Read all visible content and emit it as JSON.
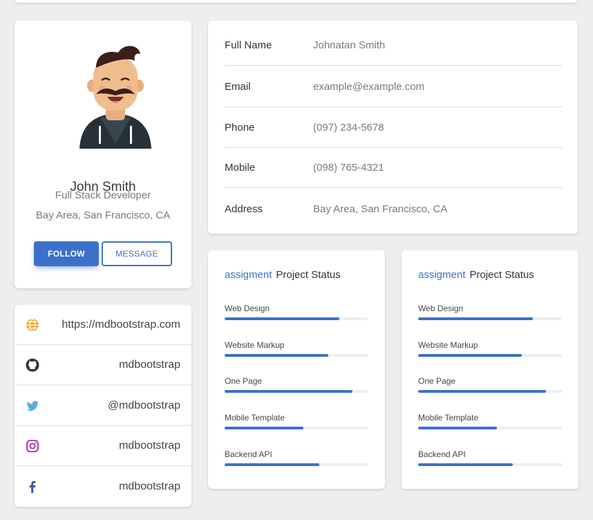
{
  "profile": {
    "name": "John Smith",
    "role": "Full Stack Developer",
    "location": "Bay Area, San Francisco, CA",
    "follow_label": "FOLLOW",
    "message_label": "MESSAGE"
  },
  "social": [
    {
      "icon": "globe-icon",
      "text": "https://mdbootstrap.com",
      "color": "#f5a623"
    },
    {
      "icon": "github-icon",
      "text": "mdbootstrap",
      "color": "#333333"
    },
    {
      "icon": "twitter-icon",
      "text": "@mdbootstrap",
      "color": "#55acee"
    },
    {
      "icon": "instagram-icon",
      "text": "mdbootstrap",
      "color": "#ac2bac"
    },
    {
      "icon": "facebook-icon",
      "text": "mdbootstrap",
      "color": "#3b5998"
    }
  ],
  "info": [
    {
      "label": "Full Name",
      "value": "Johnatan Smith"
    },
    {
      "label": "Email",
      "value": "example@example.com"
    },
    {
      "label": "Phone",
      "value": "(097) 234-5678"
    },
    {
      "label": "Mobile",
      "value": "(098) 765-4321"
    },
    {
      "label": "Address",
      "value": "Bay Area, San Francisco, CA"
    }
  ],
  "projects": [
    {
      "accent": "assigment",
      "title": "Project Status",
      "skills": [
        {
          "label": "Web Design",
          "progress": 80
        },
        {
          "label": "Website Markup",
          "progress": 72
        },
        {
          "label": "One Page",
          "progress": 89
        },
        {
          "label": "Mobile Template",
          "progress": 55
        },
        {
          "label": "Backend API",
          "progress": 66
        }
      ]
    },
    {
      "accent": "assigment",
      "title": "Project Status",
      "skills": [
        {
          "label": "Web Design",
          "progress": 80
        },
        {
          "label": "Website Markup",
          "progress": 72
        },
        {
          "label": "One Page",
          "progress": 89
        },
        {
          "label": "Mobile Template",
          "progress": 55
        },
        {
          "label": "Backend API",
          "progress": 66
        }
      ]
    }
  ],
  "colors": {
    "primary": "#3b71ca",
    "background": "#eeeeee"
  }
}
